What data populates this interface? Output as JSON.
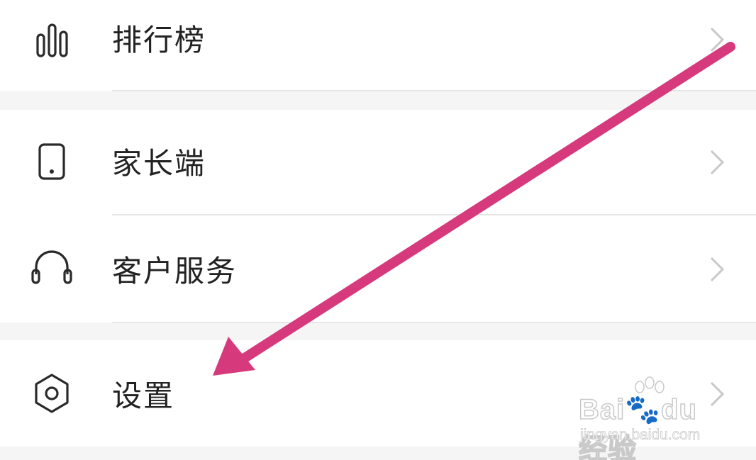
{
  "menu": {
    "items": [
      {
        "label": "排行榜",
        "icon": "bar-chart-icon"
      },
      {
        "label": "家长端",
        "icon": "tablet-icon"
      },
      {
        "label": "客户服务",
        "icon": "headset-icon"
      },
      {
        "label": "设置",
        "icon": "settings-hexagon-icon"
      }
    ]
  },
  "annotation": {
    "arrow_color": "#d63a7c",
    "points_to": "设置"
  },
  "watermark": {
    "brand": "Bai🐾du经验",
    "url": "jingyan.baidu.com"
  },
  "colors": {
    "background": "#f5f5f5",
    "row": "#ffffff",
    "text": "#222222",
    "divider": "#e6e6e6",
    "chevron": "#c8c8c8"
  }
}
